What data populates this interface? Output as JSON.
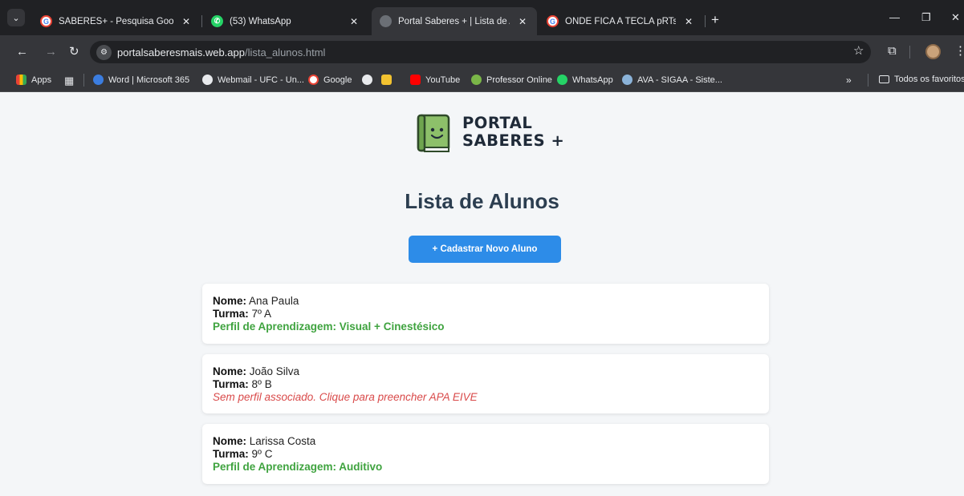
{
  "browser": {
    "tabs": [
      {
        "title": "SABERES+ - Pesquisa Google",
        "favicon": "google-icon",
        "active": false
      },
      {
        "title": "(53) WhatsApp",
        "favicon": "whatsapp-icon",
        "active": false
      },
      {
        "title": "Portal Saberes + | Lista de Aluno",
        "favicon": "globe-icon",
        "active": true
      },
      {
        "title": "ONDE FICA A TECLA pRTsCN - ",
        "favicon": "google-icon",
        "active": false
      }
    ],
    "new_tab_label": "+",
    "address": {
      "host": "portalsaberesmais.web.app",
      "path": "/lista_alunos.html"
    },
    "bookmarks": [
      {
        "label": "Apps",
        "icon": "apps-grid-icon"
      },
      {
        "label": "Word | Microsoft 365",
        "icon": "word-icon"
      },
      {
        "label": "Webmail - UFC - Un...",
        "icon": "globe-icon"
      },
      {
        "label": "Google",
        "icon": "google-icon"
      },
      {
        "label": "YouTube",
        "icon": "youtube-icon"
      },
      {
        "label": "Professor Online",
        "icon": "professor-icon"
      },
      {
        "label": "WhatsApp",
        "icon": "whatsapp-icon"
      },
      {
        "label": "AVA - SIGAA - Siste...",
        "icon": "sigaa-icon"
      }
    ],
    "more_bookmarks_label": "»",
    "all_bookmarks_label": "Todos os favoritos"
  },
  "page": {
    "logo": {
      "line1": "PORTAL",
      "line2": "SABERES +"
    },
    "title": "Lista de Alunos",
    "add_button_label": "+ Cadastrar Novo Aluno",
    "field_labels": {
      "name": "Nome:",
      "class": "Turma:"
    },
    "students": [
      {
        "name": "Ana Paula",
        "class": "7º A",
        "profile": "Perfil de Aprendizagem: Visual + Cinestésico",
        "has_profile": true
      },
      {
        "name": "João Silva",
        "class": "8º B",
        "profile": "Sem perfil associado. Clique para preencher APA EIVE",
        "has_profile": false
      },
      {
        "name": "Larissa Costa",
        "class": "9º C",
        "profile": "Perfil de Aprendizagem: Auditivo",
        "has_profile": true
      }
    ]
  },
  "colors": {
    "accent": "#2d8ce8",
    "profile_ok": "#3fa33f",
    "profile_missing": "#d94a4a",
    "page_background": "#f4f6f8",
    "title": "#2c3e50"
  }
}
